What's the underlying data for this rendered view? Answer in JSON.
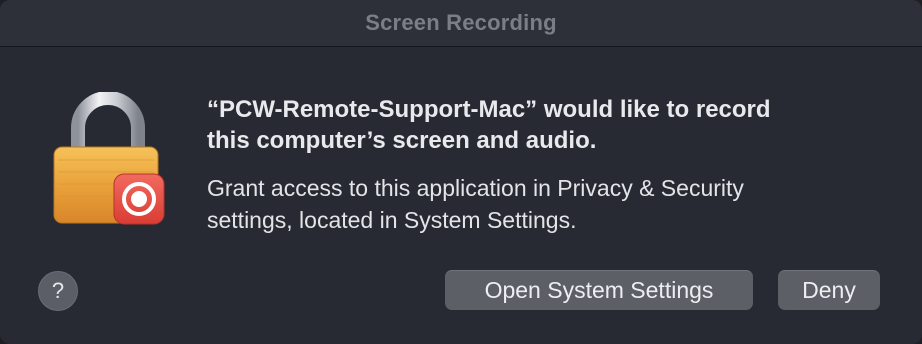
{
  "dialog": {
    "title": "Screen Recording",
    "heading": "“PCW-Remote-Support-Mac” would like to record\nthis computer’s screen and audio.",
    "message": "Grant access to this application in Privacy & Security\nsettings, located in System Settings.",
    "icon": "lock-with-record-badge-icon"
  },
  "buttons": {
    "help_label": "?",
    "open_settings_label": "Open System Settings",
    "deny_label": "Deny"
  },
  "colors": {
    "lock_body": "#e9a13a",
    "record_badge": "#e0463f"
  }
}
